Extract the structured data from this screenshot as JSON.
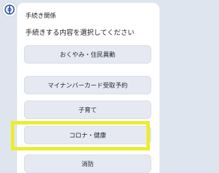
{
  "avatar": {
    "icon": "city-emblem-icon",
    "color": "#1c4aa0"
  },
  "card": {
    "title": "手続き関係",
    "subtitle": "手続きする内容を選択してください"
  },
  "menu": [
    {
      "label": "おくやみ・住民異動"
    },
    {
      "label": "マイナンバーカード受取予約"
    },
    {
      "label": "子育て"
    },
    {
      "label": "コロナ・健康"
    },
    {
      "label": "消防"
    }
  ],
  "highlight": {
    "color": "#ecec2e",
    "target": "コロナ・健康"
  }
}
